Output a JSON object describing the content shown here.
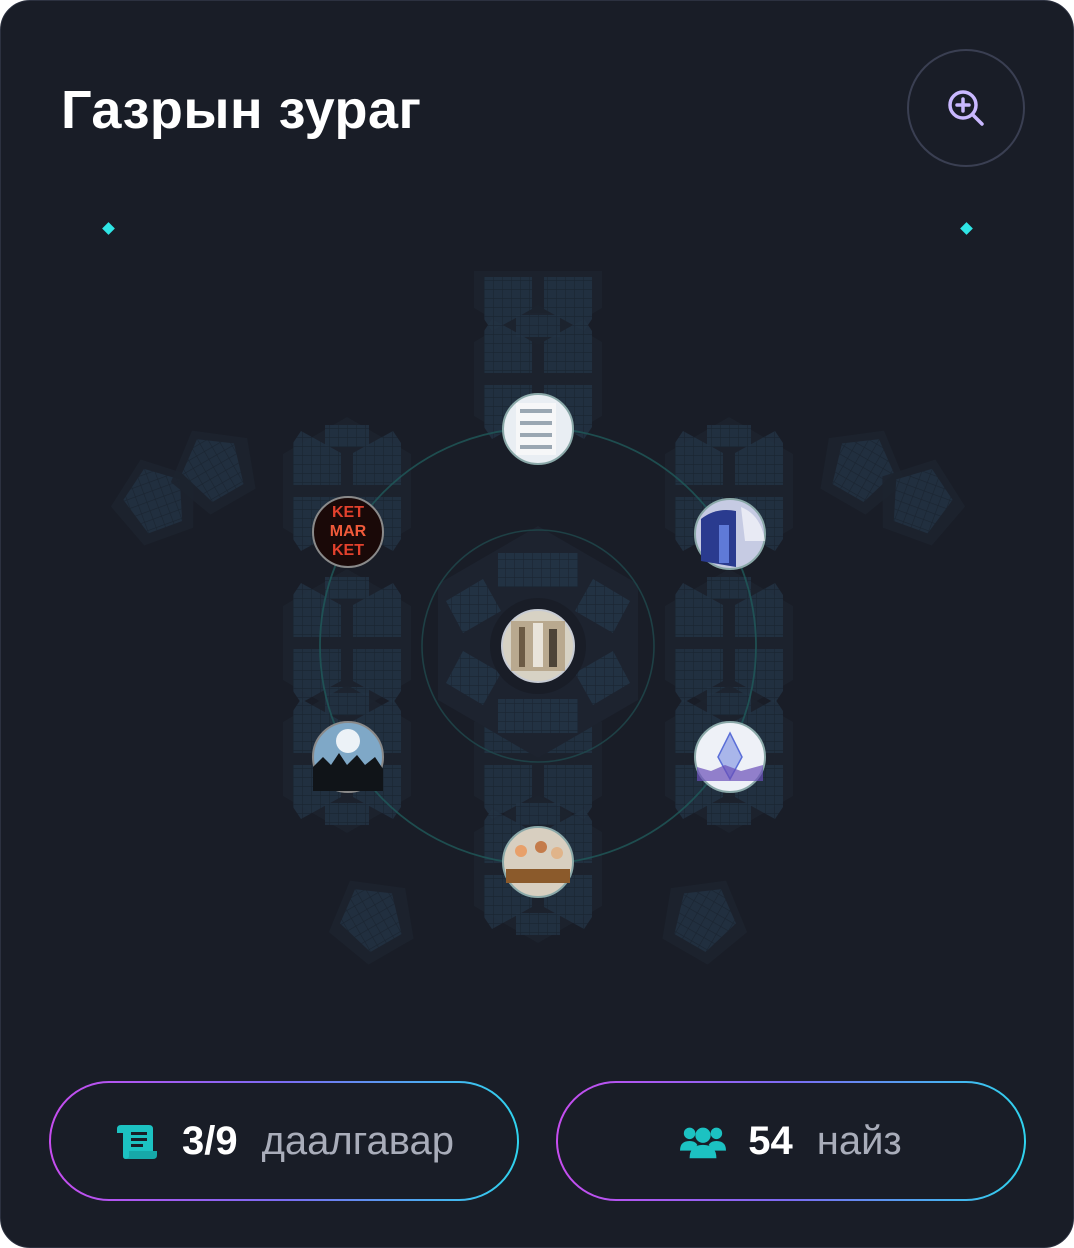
{
  "header": {
    "title": "Газрын зураг",
    "zoom_icon": "zoom-in-icon"
  },
  "map": {
    "locations": [
      {
        "name": "center",
        "icon": "building-interior-photo"
      },
      {
        "name": "top",
        "icon": "building-photo"
      },
      {
        "name": "upper-left",
        "icon": "market-neon-photo"
      },
      {
        "name": "upper-right",
        "icon": "city-photo"
      },
      {
        "name": "lower-left",
        "icon": "concert-photo"
      },
      {
        "name": "lower-right",
        "icon": "ethereum-photo"
      },
      {
        "name": "bottom",
        "icon": "classroom-photo"
      }
    ]
  },
  "stats": {
    "tasks": {
      "icon": "scroll-icon",
      "value": "3/9",
      "label": "даалгавар"
    },
    "friends": {
      "icon": "friends-icon",
      "value": "54",
      "label": "найз"
    }
  },
  "colors": {
    "background": "#191d27",
    "accent_cyan": "#2fd3ee",
    "accent_purple": "#c74df0",
    "teal": "#1cc2c2",
    "zoom_icon": "#c9b8ff"
  }
}
